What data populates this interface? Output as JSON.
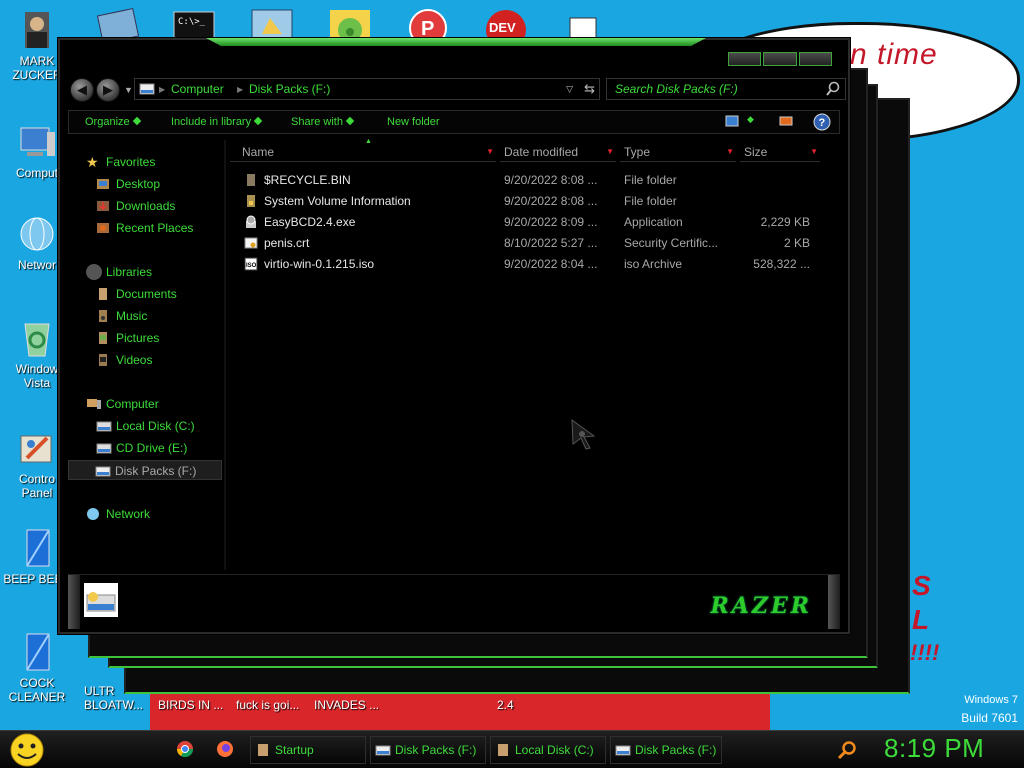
{
  "wallpaper": {
    "bubble_text": "n time",
    "red_letters": [
      "S",
      "L",
      "!!!!"
    ],
    "edition_line1": "Windows 7",
    "edition_line2": "Build 7601"
  },
  "desktop_icons": [
    {
      "label": "MARK ZUCKER",
      "icon": "mark-zuckerberg-icon"
    },
    {
      "label": "Comput",
      "icon": "computer-icon"
    },
    {
      "label": "Networ",
      "icon": "network-icon"
    },
    {
      "label": "Window Vista",
      "icon": "recycle-bin-icon"
    },
    {
      "label": "Contro Panel",
      "icon": "control-panel-icon"
    },
    {
      "label": "BEEP BEEP",
      "icon": "beep-icon"
    },
    {
      "label": "COCK CLEANER",
      "icon": "cleaner-icon"
    }
  ],
  "under_labels": [
    "ULTR BLOATW...",
    "BIRDS IN ...",
    "fuck is goi...",
    "INVADES ...",
    "2.4"
  ],
  "window": {
    "breadcrumb": [
      "Computer",
      "Disk Packs (F:)"
    ],
    "search_placeholder": "Search Disk Packs (F:)",
    "commands": [
      "Organize",
      "Include in library",
      "Share with",
      "New folder"
    ],
    "nav": {
      "favorites": {
        "label": "Favorites",
        "items": [
          "Desktop",
          "Downloads",
          "Recent Places"
        ]
      },
      "libraries": {
        "label": "Libraries",
        "items": [
          "Documents",
          "Music",
          "Pictures",
          "Videos"
        ]
      },
      "computer": {
        "label": "Computer",
        "items": [
          "Local Disk (C:)",
          "CD Drive (E:)",
          "Disk Packs (F:)"
        ]
      },
      "network": {
        "label": "Network"
      }
    },
    "columns": [
      "Name",
      "Date modified",
      "Type",
      "Size"
    ],
    "files": [
      {
        "name": "$RECYCLE.BIN",
        "date": "9/20/2022 8:08 ...",
        "type": "File folder",
        "size": "",
        "icon": "folder-icon"
      },
      {
        "name": "System Volume Information",
        "date": "9/20/2022 8:08 ...",
        "type": "File folder",
        "size": "",
        "icon": "folder-lock-icon"
      },
      {
        "name": "EasyBCD2.4.exe",
        "date": "9/20/2022 8:09 ...",
        "type": "Application",
        "size": "2,229 KB",
        "icon": "installer-icon"
      },
      {
        "name": "penis.crt",
        "date": "8/10/2022 5:27 ...",
        "type": "Security Certific...",
        "size": "2 KB",
        "icon": "certificate-icon"
      },
      {
        "name": "virtio-win-0.1.215.iso",
        "date": "9/20/2022 8:04 ...",
        "type": "iso Archive",
        "size": "528,322 ...",
        "icon": "iso-icon"
      }
    ],
    "razer_logo": "RAZER"
  },
  "taskbar": {
    "buttons": [
      "Startup",
      "Disk Packs (F:)",
      "Local Disk (C:)",
      "Disk Packs (F:)"
    ],
    "clock": "8:19 PM"
  },
  "colors": {
    "accent_green": "#3ddc3a",
    "desktop_blue": "#1aa6e0",
    "window_bg": "#000000",
    "sort_arrow_red": "#e0242c"
  }
}
